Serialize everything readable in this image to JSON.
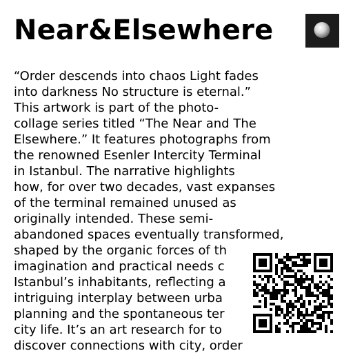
{
  "title": "Near&Elsewhere",
  "thumbnail_icon": "sphere-thumbnail",
  "description_lines": [
    "“Order descends into chaos Light fades",
    "into darkness No structure is eternal.”",
    "This artwork is part of the photo-",
    "collage series titled “The Near and The",
    "Elsewhere.” It features photographs from",
    "the renowned Esenler Intercity Terminal",
    "in Istanbul. The narrative highlights",
    "how, for over two decades, vast expanses",
    "of the terminal remained unused as",
    "originally intended. These semi-",
    "abandoned spaces eventually transformed,",
    "shaped by the organic forces of th",
    "imagination and practical needs c",
    "Istanbul’s inhabitants, reflecting a",
    "intriguing interplay between urba",
    "planning and the spontaneous ter",
    "city life. It’s an art research for to",
    "discover connections with city, order"
  ],
  "qr_icon": "qr-code-icon",
  "colors": {
    "background": "#ffffff",
    "text": "#000000",
    "thumbnail_bg": "#1c1c1c"
  }
}
